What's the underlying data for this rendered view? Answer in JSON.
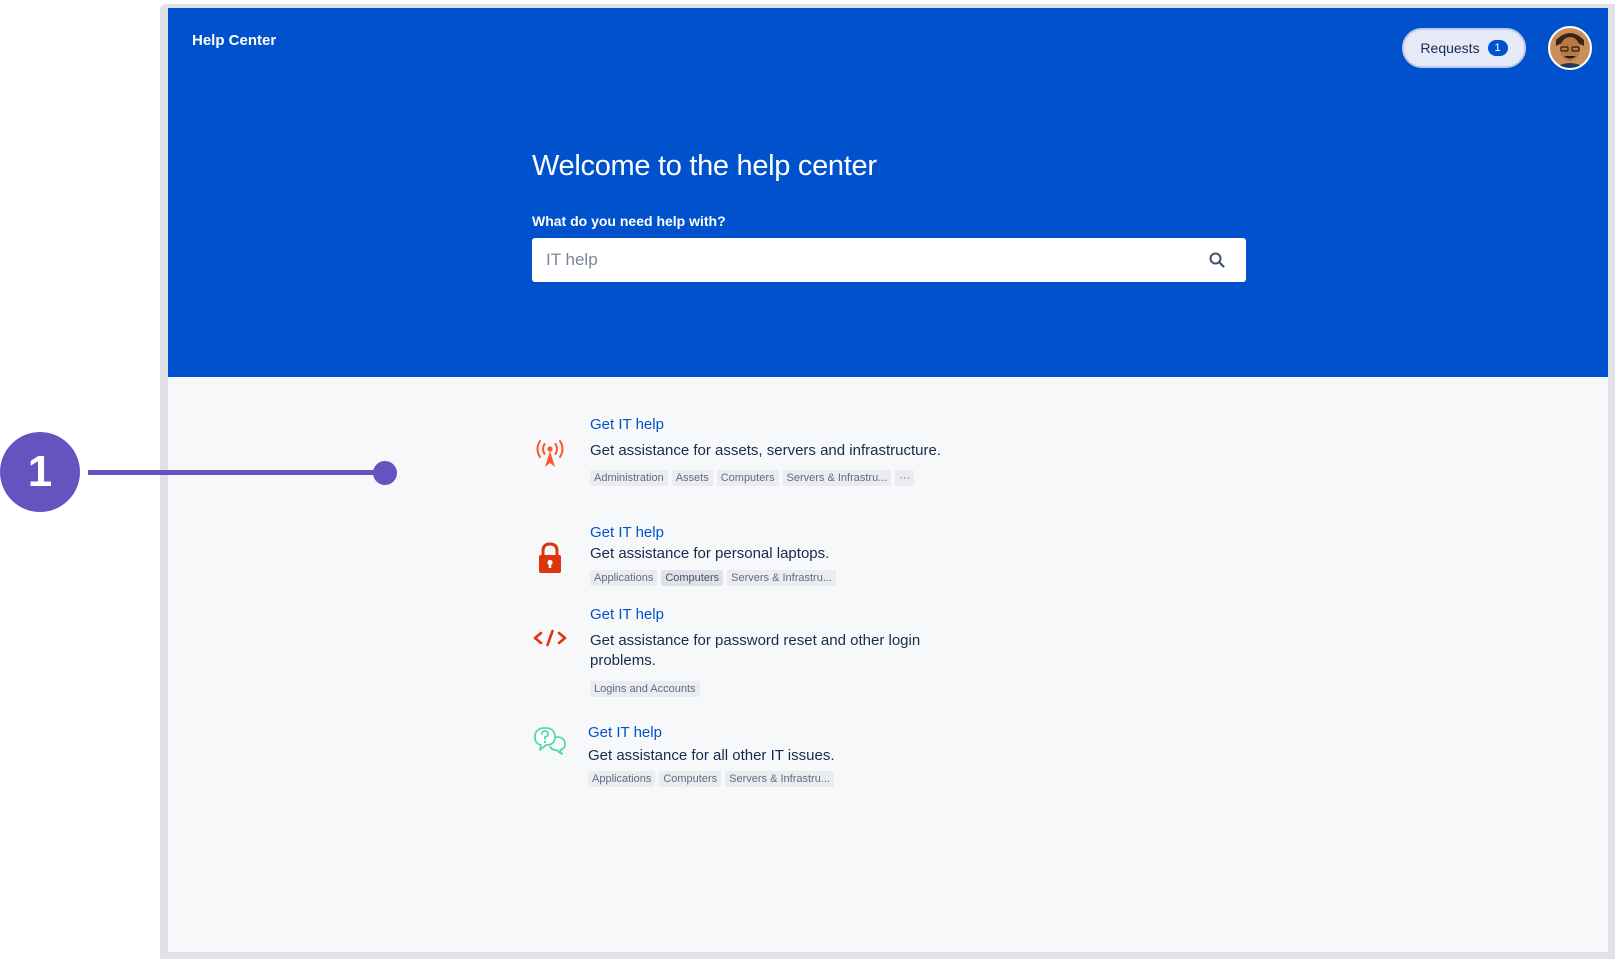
{
  "header": {
    "brand": "Help Center",
    "requests_label": "Requests",
    "requests_count": "1"
  },
  "hero": {
    "title": "Welcome to the help center",
    "search_label": "What do you need help with?",
    "search_placeholder": "IT help"
  },
  "request_types": [
    {
      "title": "Get IT help",
      "description": "Get assistance for assets, servers and infrastructure.",
      "icon": "broadcast-tower-icon",
      "icon_color": "#ff5630",
      "tags": [
        "Administration",
        "Assets",
        "Computers",
        "Servers & Infrastru...",
        "···"
      ]
    },
    {
      "title": "Get IT help",
      "description": "Get assistance for personal laptops.",
      "icon": "lock-icon",
      "icon_color": "#de350b",
      "tags": [
        "Applications",
        "Computers",
        "Servers & Infrastru..."
      ]
    },
    {
      "title": "Get IT help",
      "description": "Get assistance for password reset and other login problems.",
      "icon": "code-icon",
      "icon_color": "#de350b",
      "tags": [
        "Logins and Accounts"
      ]
    },
    {
      "title": "Get IT help",
      "description": "Get assistance for all other IT issues.",
      "icon": "question-chat-icon",
      "icon_color": "#57d9a3",
      "tags": [
        "Applications",
        "Computers",
        "Servers & Infrastru..."
      ]
    }
  ],
  "callout": {
    "number": "1",
    "color": "#6554c0"
  },
  "colors": {
    "brand_blue": "#0052cc",
    "link": "#0052cc",
    "background": "#f7f8fa"
  }
}
